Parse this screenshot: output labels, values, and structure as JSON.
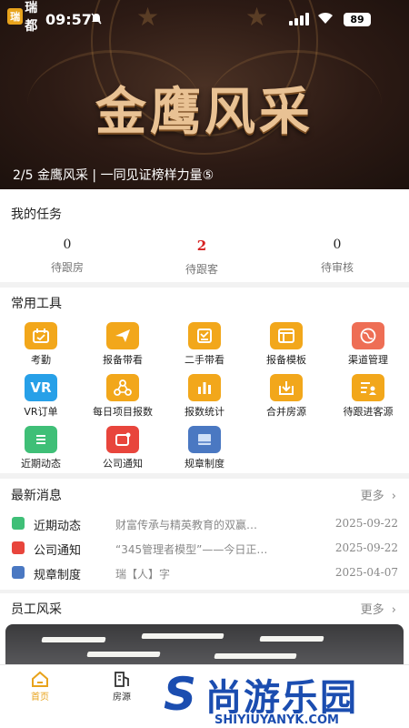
{
  "status_bar": {
    "app_logo_text": "瑞都",
    "logo_mark": "瑞",
    "time": "09:57",
    "battery": "89"
  },
  "banner": {
    "title": "金鹰风采",
    "caption": "2/5 金鹰风采 | 一同见证榜样力量⑤"
  },
  "tasks": {
    "title": "我的任务",
    "items": [
      {
        "count": "0",
        "label": "待跟房"
      },
      {
        "count": "2",
        "label": "待跟客"
      },
      {
        "count": "0",
        "label": "待审核"
      }
    ]
  },
  "tools": {
    "title": "常用工具",
    "items": [
      {
        "label": "考勤",
        "icon": "calendar-icon",
        "color": "#f2a71b"
      },
      {
        "label": "报备带看",
        "icon": "paper-plane-icon",
        "color": "#f2a71b"
      },
      {
        "label": "二手带看",
        "icon": "checklist-icon",
        "color": "#f2a71b"
      },
      {
        "label": "报备模板",
        "icon": "template-icon",
        "color": "#f2a71b"
      },
      {
        "label": "渠道管理",
        "icon": "globe-icon",
        "color": "#ee6e55"
      },
      {
        "label": "VR订单",
        "icon": "vr-icon",
        "color": "#27a0e8"
      },
      {
        "label": "每日项目报数",
        "icon": "network-icon",
        "color": "#f2a71b"
      },
      {
        "label": "报数统计",
        "icon": "bar-chart-icon",
        "color": "#f2a71b"
      },
      {
        "label": "合并房源",
        "icon": "merge-icon",
        "color": "#f2a71b"
      },
      {
        "label": "待跟进客源",
        "icon": "user-list-icon",
        "color": "#f2a71b"
      },
      {
        "label": "近期动态",
        "icon": "list-icon",
        "color": "#3fbf77"
      },
      {
        "label": "公司通知",
        "icon": "notice-icon",
        "color": "#e8453c"
      },
      {
        "label": "规章制度",
        "icon": "book-icon",
        "color": "#4a78c2"
      }
    ]
  },
  "news": {
    "title": "最新消息",
    "more": "更多",
    "items": [
      {
        "category": "近期动态",
        "text": "财富传承与精英教育的双赢…",
        "date": "2025-09-22",
        "color": "#3fbf77"
      },
      {
        "category": "公司通知",
        "text": "“345管理者模型”——今日正…",
        "date": "2025-09-22",
        "color": "#e8453c"
      },
      {
        "category": "规章制度",
        "text": "瑞【人】字",
        "date": "2025-04-07",
        "color": "#4a78c2"
      }
    ]
  },
  "staff": {
    "title": "员工风采",
    "more": "更多"
  },
  "tabbar": {
    "items": [
      {
        "label": "首页"
      },
      {
        "label": "房源"
      }
    ]
  },
  "watermark": {
    "name": "尚游乐园",
    "url": "SHIYIUYANYK.COM"
  },
  "colors": {
    "accent": "#e8a31c",
    "alert": "#d62020"
  }
}
